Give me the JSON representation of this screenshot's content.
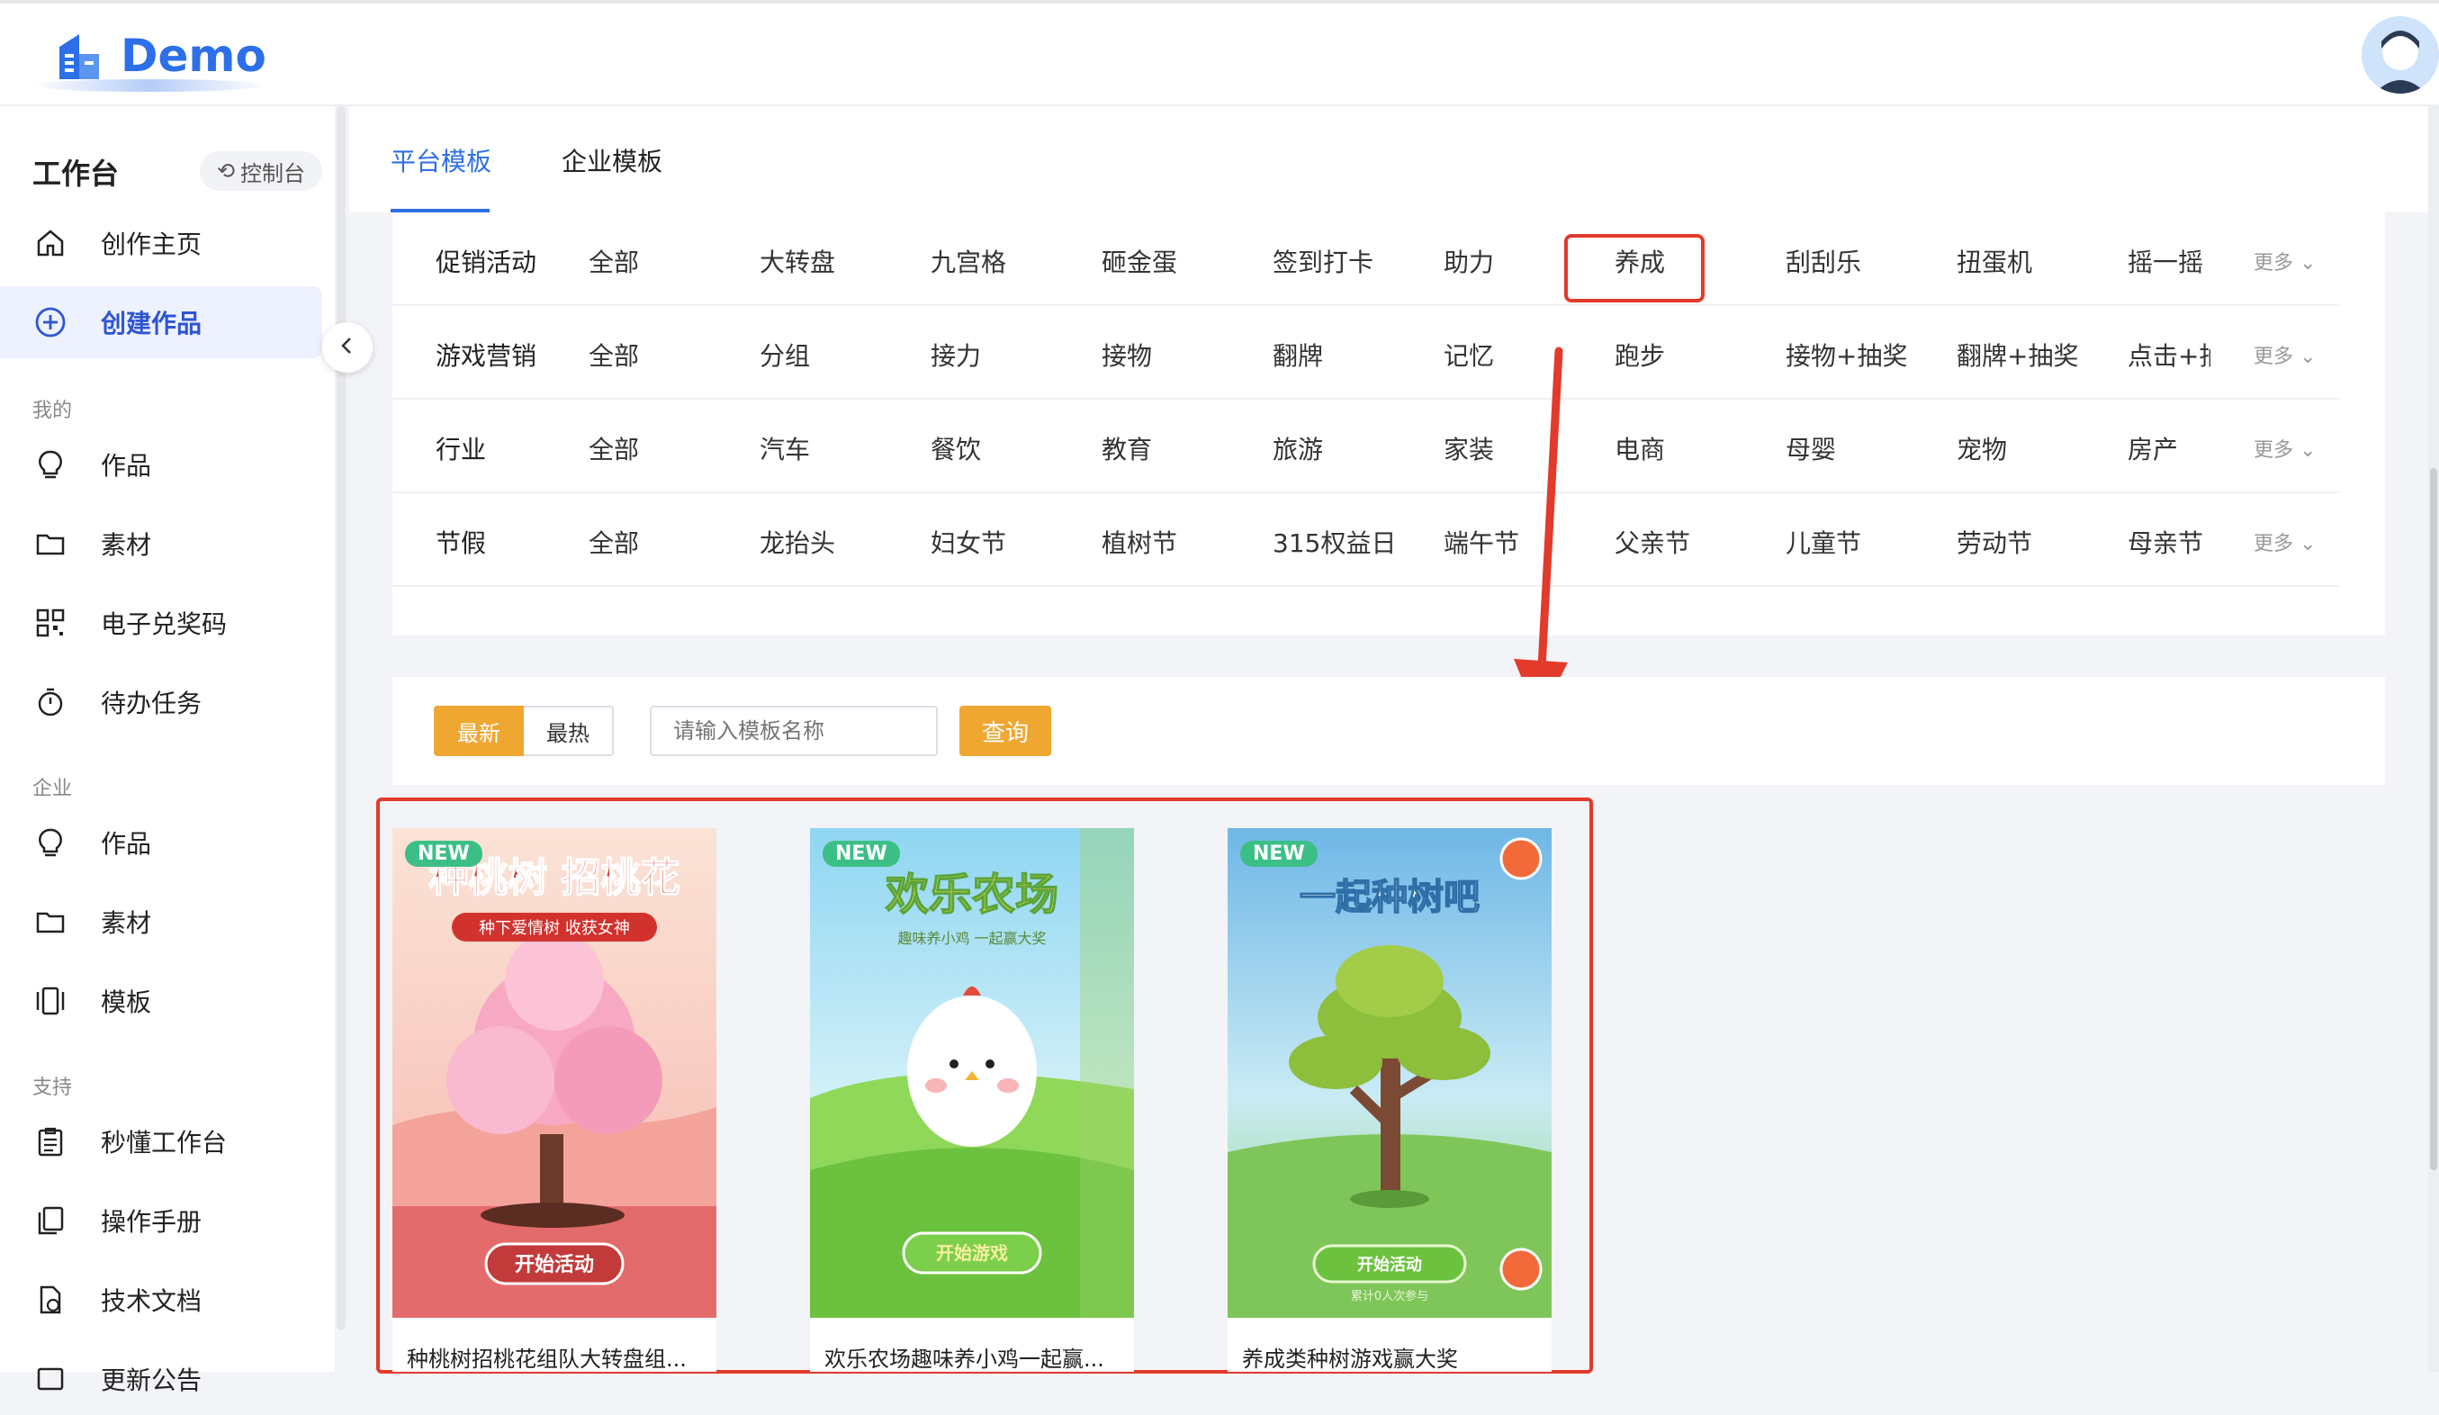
{
  "app": {
    "title": "Demo",
    "accent": "#2f6fe8",
    "highlight": "#e23a2b",
    "button": "#f0a732"
  },
  "sidebar": {
    "workspace_title": "工作台",
    "switch_label": "控制台",
    "items_top": [
      {
        "label": "创作主页",
        "icon": "home-icon"
      },
      {
        "label": "创建作品",
        "icon": "plus-circle-icon"
      }
    ],
    "section_mine": "我的",
    "items_mine": [
      {
        "label": "作品",
        "icon": "bulb-icon"
      },
      {
        "label": "素材",
        "icon": "folder-icon"
      },
      {
        "label": "电子兑奖码",
        "icon": "qrcode-icon"
      },
      {
        "label": "待办任务",
        "icon": "timer-icon"
      }
    ],
    "section_enterprise": "企业",
    "items_enterprise": [
      {
        "label": "作品",
        "icon": "bulb-icon"
      },
      {
        "label": "素材",
        "icon": "folder-icon"
      },
      {
        "label": "模板",
        "icon": "template-icon"
      }
    ],
    "section_support": "支持",
    "items_support": [
      {
        "label": "秒懂工作台",
        "icon": "clipboard-icon"
      },
      {
        "label": "操作手册",
        "icon": "manual-icon"
      },
      {
        "label": "技术文档",
        "icon": "doc-icon"
      },
      {
        "label": "更新公告",
        "icon": "notice-icon"
      }
    ]
  },
  "tabs": [
    {
      "label": "平台模板"
    },
    {
      "label": "企业模板"
    }
  ],
  "filters": [
    {
      "label": "促销活动",
      "options": [
        "全部",
        "大转盘",
        "九宫格",
        "砸金蛋",
        "签到打卡",
        "助力",
        "养成",
        "刮刮乐",
        "扭蛋机",
        "摇一摇"
      ]
    },
    {
      "label": "游戏营销",
      "options": [
        "全部",
        "分组",
        "接力",
        "接物",
        "翻牌",
        "记忆",
        "跑步",
        "接物+抽奖",
        "翻牌+抽奖",
        "点击+抽"
      ]
    },
    {
      "label": "行业",
      "options": [
        "全部",
        "汽车",
        "餐饮",
        "教育",
        "旅游",
        "家装",
        "电商",
        "母婴",
        "宠物",
        "房产"
      ]
    },
    {
      "label": "节假",
      "options": [
        "全部",
        "龙抬头",
        "妇女节",
        "植树节",
        "315权益日",
        "端午节",
        "父亲节",
        "儿童节",
        "劳动节",
        "母亲节"
      ]
    }
  ],
  "more_label": "更多",
  "search": {
    "sort_new": "最新",
    "sort_hot": "最热",
    "placeholder": "请输入模板名称",
    "button": "查询"
  },
  "cards": [
    {
      "badge": "NEW",
      "title": "种桃树招桃花组队大转盘组...",
      "poster_title": "种桃树 招桃花",
      "poster_sub": "种下爱情树 收获女神",
      "cta": "开始活动"
    },
    {
      "badge": "NEW",
      "title": "欢乐农场趣味养小鸡一起赢...",
      "poster_title": "欢乐农场",
      "poster_sub": "趣味养小鸡 一起赢大奖",
      "cta": "开始游戏"
    },
    {
      "badge": "NEW",
      "title": "养成类种树游戏赢大奖",
      "poster_title": "一起种树吧",
      "poster_sub": "累计0人次参与",
      "cta": "开始活动"
    }
  ]
}
